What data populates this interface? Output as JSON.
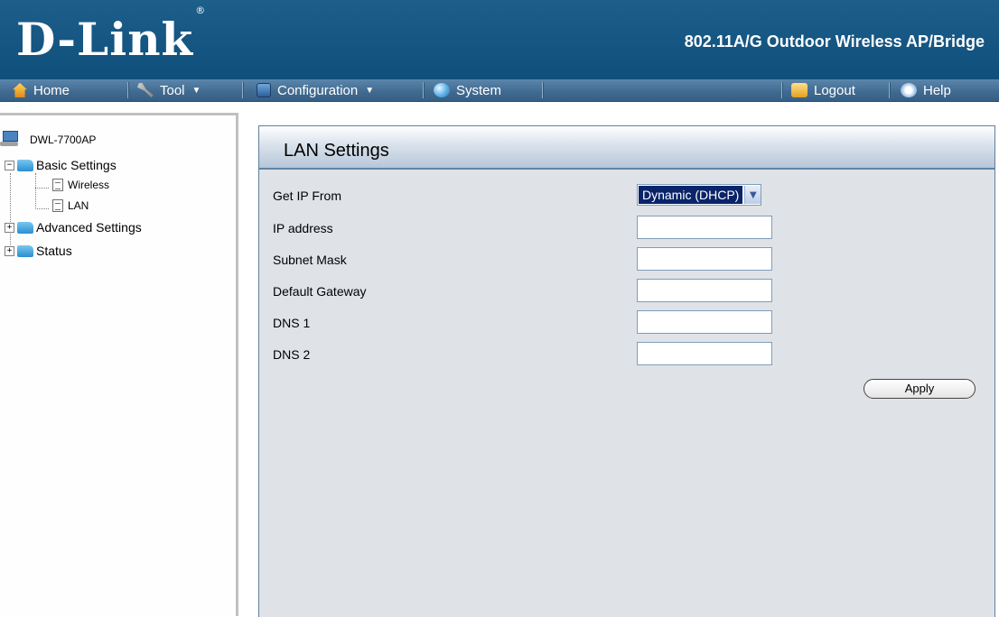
{
  "header": {
    "brand": "D-Link",
    "product_title": "802.11A/G Outdoor Wireless AP/Bridge"
  },
  "menu": {
    "home": "Home",
    "tool": "Tool",
    "configuration": "Configuration",
    "system": "System",
    "logout": "Logout",
    "help": "Help"
  },
  "tree": {
    "root": "DWL-7700AP",
    "basic_settings": "Basic Settings",
    "wireless": "Wireless",
    "lan": "LAN",
    "advanced_settings": "Advanced Settings",
    "status": "Status"
  },
  "panel": {
    "title": "LAN Settings",
    "get_ip_label": "Get IP From",
    "get_ip_value": "Dynamic (DHCP)",
    "ip_address_label": "IP address",
    "ip_address_value": "",
    "subnet_mask_label": "Subnet Mask",
    "subnet_mask_value": "",
    "gateway_label": "Default Gateway",
    "gateway_value": "",
    "dns1_label": "DNS 1",
    "dns1_value": "",
    "dns2_label": "DNS 2",
    "dns2_value": "",
    "apply_label": "Apply"
  },
  "colors": {
    "header_bg": "#15577f",
    "menubar_bg": "#40698f",
    "panel_bg": "#dfe3e8",
    "panel_border": "#5f7f9f"
  }
}
